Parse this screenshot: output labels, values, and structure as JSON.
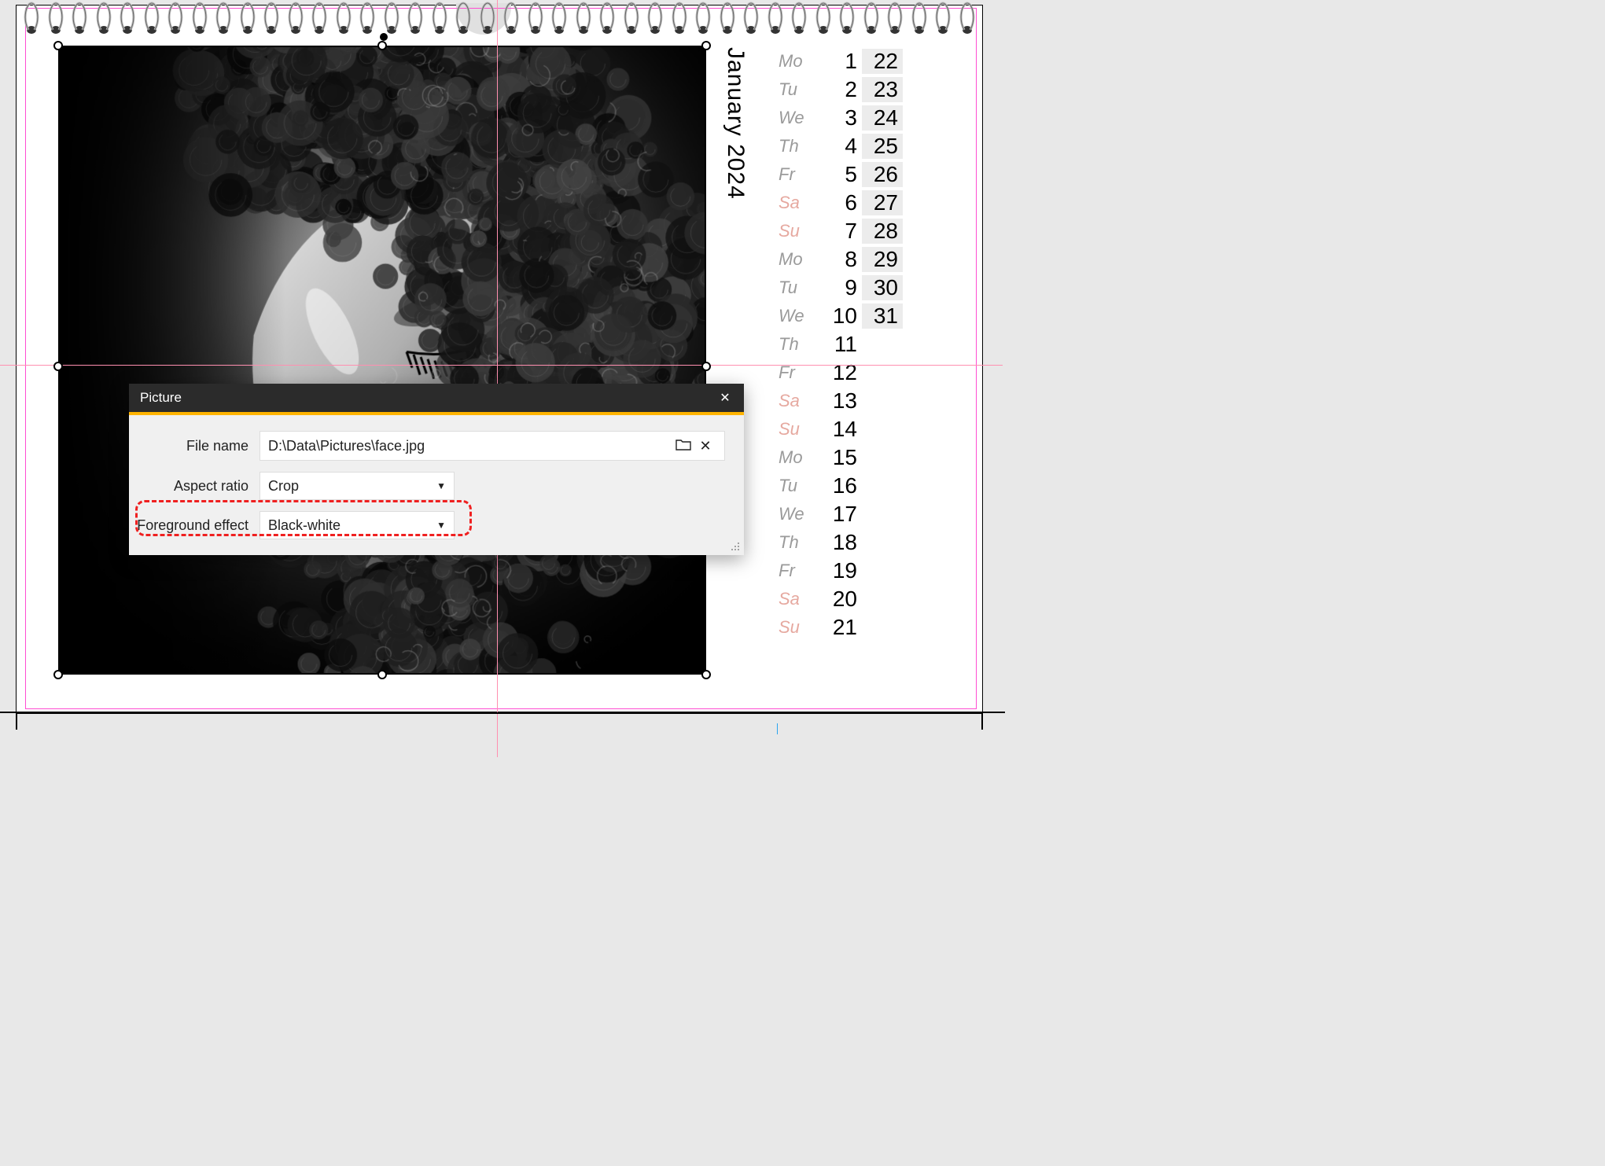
{
  "month_label": "January 2024",
  "calendar": {
    "rows": [
      {
        "dow": "Mo",
        "col1": "1",
        "col2": "22",
        "weekend": false
      },
      {
        "dow": "Tu",
        "col1": "2",
        "col2": "23",
        "weekend": false
      },
      {
        "dow": "We",
        "col1": "3",
        "col2": "24",
        "weekend": false
      },
      {
        "dow": "Th",
        "col1": "4",
        "col2": "25",
        "weekend": false
      },
      {
        "dow": "Fr",
        "col1": "5",
        "col2": "26",
        "weekend": false
      },
      {
        "dow": "Sa",
        "col1": "6",
        "col2": "27",
        "weekend": true
      },
      {
        "dow": "Su",
        "col1": "7",
        "col2": "28",
        "weekend": true
      },
      {
        "dow": "Mo",
        "col1": "8",
        "col2": "29",
        "weekend": false
      },
      {
        "dow": "Tu",
        "col1": "9",
        "col2": "30",
        "weekend": false
      },
      {
        "dow": "We",
        "col1": "10",
        "col2": "31",
        "weekend": false
      },
      {
        "dow": "Th",
        "col1": "11",
        "col2": "",
        "weekend": false
      },
      {
        "dow": "Fr",
        "col1": "12",
        "col2": "",
        "weekend": false
      },
      {
        "dow": "Sa",
        "col1": "13",
        "col2": "",
        "weekend": true
      },
      {
        "dow": "Su",
        "col1": "14",
        "col2": "",
        "weekend": true
      },
      {
        "dow": "Mo",
        "col1": "15",
        "col2": "",
        "weekend": false
      },
      {
        "dow": "Tu",
        "col1": "16",
        "col2": "",
        "weekend": false
      },
      {
        "dow": "We",
        "col1": "17",
        "col2": "",
        "weekend": false
      },
      {
        "dow": "Th",
        "col1": "18",
        "col2": "",
        "weekend": false
      },
      {
        "dow": "Fr",
        "col1": "19",
        "col2": "",
        "weekend": false
      },
      {
        "dow": "Sa",
        "col1": "20",
        "col2": "",
        "weekend": true
      },
      {
        "dow": "Su",
        "col1": "21",
        "col2": "",
        "weekend": true
      }
    ]
  },
  "dialog": {
    "title": "Picture",
    "file_name_label": "File name",
    "file_name_value": "D:\\Data\\Pictures\\face.jpg",
    "aspect_label": "Aspect ratio",
    "aspect_value": "Crop",
    "fg_label": "Foreground effect",
    "fg_value": "Black-white"
  }
}
